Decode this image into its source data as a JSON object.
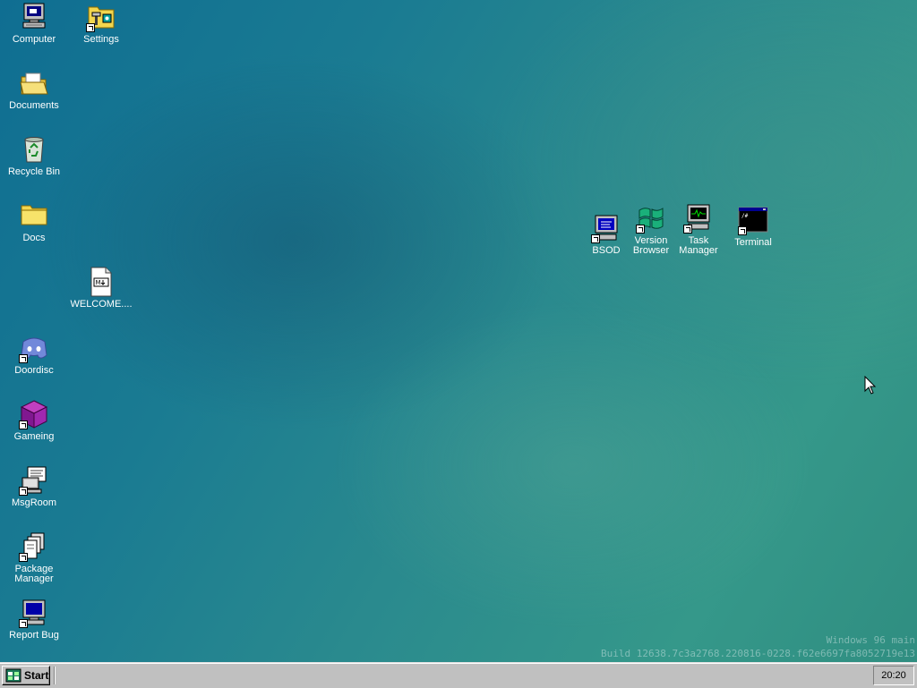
{
  "desktop": {
    "left_icons": [
      {
        "label": "Computer",
        "icon": "computer-icon"
      },
      {
        "label": "Documents",
        "icon": "open-folder-icon"
      },
      {
        "label": "Recycle Bin",
        "icon": "recycle-bin-icon"
      },
      {
        "label": "Docs",
        "icon": "folder-icon"
      },
      {
        "label": "Doordisc",
        "icon": "discord-icon"
      },
      {
        "label": "Gameing",
        "icon": "cube-icon"
      },
      {
        "label": "MsgRoom",
        "icon": "msgroom-icon"
      },
      {
        "label": "Package\nManager",
        "icon": "package-icon"
      },
      {
        "label": "Report Bug",
        "icon": "monitor-icon"
      }
    ],
    "settings": {
      "label": "Settings",
      "icon": "settings-folder-icon"
    },
    "welcome": {
      "label": "WELCOME....",
      "icon": "markdown-file-icon"
    },
    "right_icons": [
      {
        "label": "BSOD",
        "icon": "bsod-icon"
      },
      {
        "label": "Version\nBrowser",
        "icon": "windows-flag-icon"
      },
      {
        "label": "Task\nManager",
        "icon": "task-manager-icon"
      },
      {
        "label": "Terminal",
        "icon": "terminal-icon"
      }
    ]
  },
  "watermark": {
    "line1": "Windows 96 main",
    "line2": "Build 12638.7c3a2768.220816-0228.f62e6697fa8052719e13"
  },
  "taskbar": {
    "start_label": "Start",
    "clock": "20:20"
  },
  "colors": {
    "taskbar": "#c0c0c0",
    "desktop_teal": "#2a8a8e"
  }
}
